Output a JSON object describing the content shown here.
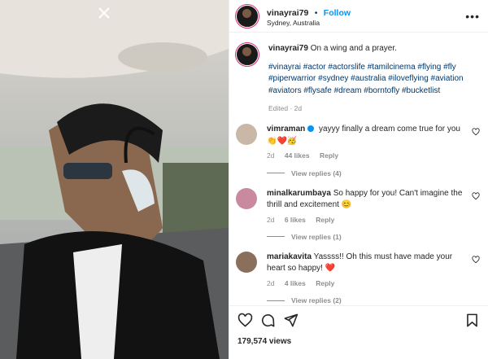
{
  "header": {
    "username": "vinayrai79",
    "dot": "•",
    "follow_label": "Follow",
    "location": "Sydney, Australia",
    "more": "•••"
  },
  "caption": {
    "username": "vinayrai79",
    "text": "On a wing and a prayer.",
    "hashtags": "#vinayrai #actor #actorslife #tamilcinema #flying #fly #piperwarrior #sydney #australia #iloveflying #aviation #aviators #flysafe #dream #borntofly #bucketlist",
    "meta": "Edited · 2d"
  },
  "comments": [
    {
      "username": "vimraman",
      "verified": true,
      "text": "yayyy finally a dream come true for you 👏❤️🥳",
      "age": "2d",
      "likes": "44 likes",
      "reply": "Reply",
      "view_replies": "View replies (4)",
      "avatar_color": "#c9b8a8"
    },
    {
      "username": "minalkarumbaya",
      "verified": false,
      "text": "So happy for you! Can't imagine the thrill and excitement 😊",
      "age": "2d",
      "likes": "6 likes",
      "reply": "Reply",
      "view_replies": "View replies (1)",
      "avatar_color": "#c98aa0"
    },
    {
      "username": "mariakavita",
      "verified": false,
      "text": "Yassss!! Oh this must have made your heart so happy! ❤️",
      "age": "2d",
      "likes": "4 likes",
      "reply": "Reply",
      "view_replies": "View replies (2)",
      "avatar_color": "#8a6f5c"
    }
  ],
  "footer": {
    "views": "179,574 views"
  },
  "icons": [
    "close-icon",
    "more-icon",
    "heart-icon",
    "comment-icon",
    "share-icon",
    "bookmark-icon",
    "verified-icon"
  ]
}
